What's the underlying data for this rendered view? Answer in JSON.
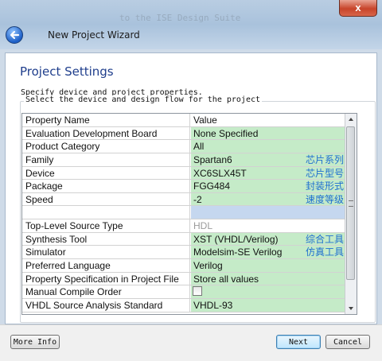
{
  "window": {
    "title": "New Project Wizard",
    "close_glyph": "x",
    "background_ghost_text": "to the ISE Design Suite"
  },
  "section": {
    "title": "Project Settings",
    "description": "Specify device and project properties.",
    "group_label": "Select the device and design flow for the project"
  },
  "table": {
    "columns": [
      "Property Name",
      "Value"
    ],
    "rows": [
      {
        "name": "Evaluation Development Board",
        "value": "None Specified",
        "annotation": ""
      },
      {
        "name": "Product Category",
        "value": "All",
        "annotation": ""
      },
      {
        "name": "Family",
        "value": "Spartan6",
        "annotation": "芯片系列"
      },
      {
        "name": "Device",
        "value": "XC6SLX45T",
        "annotation": "芯片型号"
      },
      {
        "name": "Package",
        "value": "FGG484",
        "annotation": "封装形式"
      },
      {
        "name": "Speed",
        "value": "-2",
        "annotation": "速度等级"
      },
      {
        "name": "",
        "value": "",
        "annotation": ""
      },
      {
        "name": "Top-Level Source Type",
        "value": "HDL",
        "annotation": ""
      },
      {
        "name": "Synthesis Tool",
        "value": "XST (VHDL/Verilog)",
        "annotation": "综合工具"
      },
      {
        "name": "Simulator",
        "value": "Modelsim-SE Verilog",
        "annotation": "仿真工具"
      },
      {
        "name": "Preferred Language",
        "value": "Verilog",
        "annotation": ""
      },
      {
        "name": "Property Specification in Project File",
        "value": "Store all values",
        "annotation": ""
      },
      {
        "name": "Manual Compile Order",
        "value": "",
        "annotation": ""
      },
      {
        "name": "VHDL Source Analysis Standard",
        "value": "VHDL-93",
        "annotation": ""
      }
    ]
  },
  "footer": {
    "more_info_label": "More Info",
    "next_label": "Next",
    "cancel_label": "Cancel"
  },
  "colors": {
    "value_green": "#c5ebc8",
    "value_blue": "#c5d7ef",
    "annotation_blue": "#1e6fd1",
    "title_blue": "#1f3e8c"
  },
  "icons": {
    "back": "back-arrow-icon",
    "close": "close-icon",
    "dropdown": "chevron-down-icon"
  }
}
